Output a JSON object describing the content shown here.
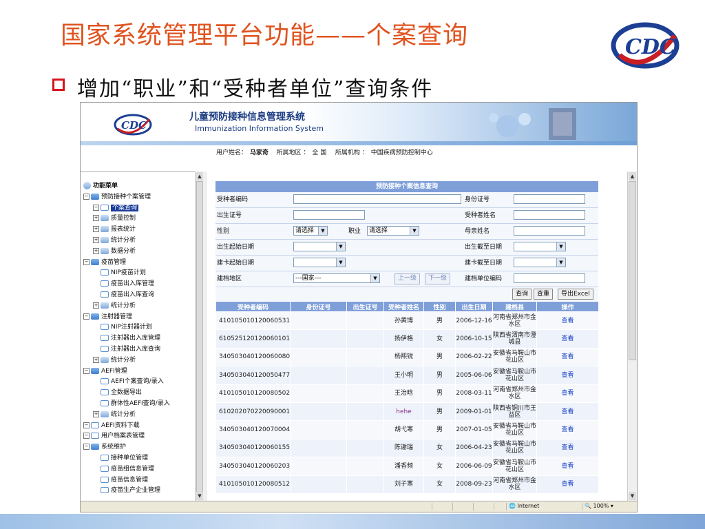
{
  "slide": {
    "title": "国家系统管理平台功能——个案查询",
    "bullet": "增加“职业”和“受种者单位”查询条件"
  },
  "system": {
    "name_cn": "儿童预防接种信息管理系统",
    "name_en": "Immunization Information System",
    "user_label": "用户姓名：",
    "user_name": "马家奇",
    "region_label": "所属地区 ：",
    "region": "全 国",
    "org_label": "所属机构 ：",
    "org": "中国疾病预防控制中心"
  },
  "menu": {
    "header": "功能菜单",
    "items": [
      {
        "label": "预防接种个案管理",
        "toggle": "⊟",
        "icon": "folder",
        "level": 0
      },
      {
        "label": "个案查询",
        "toggle": "⊟",
        "icon": "doc",
        "level": 1,
        "selected": true
      },
      {
        "label": "质量控制",
        "toggle": "⊞",
        "icon": "multi",
        "level": 1
      },
      {
        "label": "报表统计",
        "toggle": "⊞",
        "icon": "multi",
        "level": 1
      },
      {
        "label": "统计分析",
        "toggle": "⊞",
        "icon": "multi",
        "level": 1
      },
      {
        "label": "数据分析",
        "toggle": "⊞",
        "icon": "multi",
        "level": 1
      },
      {
        "label": "疫苗管理",
        "toggle": "⊟",
        "icon": "folder",
        "level": 0
      },
      {
        "label": "NIP疫苗计划",
        "toggle": "",
        "icon": "doc",
        "level": 1
      },
      {
        "label": "疫苗出入库管理",
        "toggle": "",
        "icon": "doc",
        "level": 1
      },
      {
        "label": "疫苗出入库查询",
        "toggle": "",
        "icon": "doc",
        "level": 1
      },
      {
        "label": "统计分析",
        "toggle": "⊞",
        "icon": "multi",
        "level": 1
      },
      {
        "label": "注射器管理",
        "toggle": "⊟",
        "icon": "folder",
        "level": 0
      },
      {
        "label": "NIP注射器计划",
        "toggle": "",
        "icon": "doc",
        "level": 1
      },
      {
        "label": "注射器出入库管理",
        "toggle": "",
        "icon": "doc",
        "level": 1
      },
      {
        "label": "注射器出入库查询",
        "toggle": "",
        "icon": "doc",
        "level": 1
      },
      {
        "label": "统计分析",
        "toggle": "⊞",
        "icon": "multi",
        "level": 1
      },
      {
        "label": "AEFI管理",
        "toggle": "⊟",
        "icon": "folder",
        "level": 0
      },
      {
        "label": "AEFI个案查询/录入",
        "toggle": "",
        "icon": "doc",
        "level": 1
      },
      {
        "label": "全数据导出",
        "toggle": "",
        "icon": "doc",
        "level": 1
      },
      {
        "label": "群体性AEFI查询/录入",
        "toggle": "",
        "icon": "doc",
        "level": 1
      },
      {
        "label": "统计分析",
        "toggle": "⊞",
        "icon": "multi",
        "level": 1
      },
      {
        "label": "AEFI资料下载",
        "toggle": "⊟",
        "icon": "doc",
        "level": 0
      },
      {
        "label": "用户档案表管理",
        "toggle": "⊟",
        "icon": "doc",
        "level": 0
      },
      {
        "label": "系统维护",
        "toggle": "⊟",
        "icon": "folder",
        "level": 0
      },
      {
        "label": "接种单位管理",
        "toggle": "",
        "icon": "doc",
        "level": 1
      },
      {
        "label": "疫苗组信息管理",
        "toggle": "",
        "icon": "doc",
        "level": 1
      },
      {
        "label": "疫苗信息管理",
        "toggle": "",
        "icon": "doc",
        "level": 1
      },
      {
        "label": "疫苗生产企业管理",
        "toggle": "",
        "icon": "doc",
        "level": 1
      }
    ]
  },
  "query": {
    "title": "预防接种个案信息查询",
    "labels": {
      "recipient_code": "受种者编码",
      "id_number": "身份证号",
      "birth_cert": "出生证号",
      "recipient_name": "受种者姓名",
      "gender": "性别",
      "occupation": "职业",
      "mother_name": "母亲姓名",
      "birth_start": "出生起始日期",
      "birth_end": "出生截至日期",
      "card_start": "建卡起始日期",
      "card_end": "建卡截至日期",
      "file_region": "建档地区",
      "file_unit_code": "建档单位编码"
    },
    "gender_value": "请选择",
    "occupation_value": "请选择",
    "region_value": "---国家---",
    "btn_up": "上一级",
    "btn_down": "下一级",
    "btn_query": "查询",
    "btn_reset": "查重",
    "btn_export": "导出Excel"
  },
  "results": {
    "columns": [
      "受种者编码",
      "身份证号",
      "出生证号",
      "受种者姓名",
      "性别",
      "出生日期",
      "建档县",
      "操作"
    ],
    "rows": [
      {
        "code": "410105010120060531",
        "name": "孙黄博",
        "gender": "男",
        "dob": "2006-12-16",
        "county": "河南省郑州市金水区",
        "op": "查看"
      },
      {
        "code": "610525120120060101",
        "name": "扬伊格",
        "gender": "女",
        "dob": "2006-10-15",
        "county": "陕西省渭南市澄城县",
        "op": "查看"
      },
      {
        "code": "340503040120060080",
        "name": "杨熙锐",
        "gender": "男",
        "dob": "2006-02-22",
        "county": "安徽省马鞍山市花山区",
        "op": "查看"
      },
      {
        "code": "340503040120050477",
        "name": "王小明",
        "gender": "男",
        "dob": "2005-06-06",
        "county": "安徽省马鞍山市花山区",
        "op": "查看"
      },
      {
        "code": "410105010120080502",
        "name": "王治晗",
        "gender": "男",
        "dob": "2008-03-11",
        "county": "河南省郑州市金水区",
        "op": "查看"
      },
      {
        "code": "610202070220090001",
        "name": "hehe",
        "gender": "男",
        "dob": "2009-01-01",
        "county": "陕西省铜川市王益区",
        "op": "查看"
      },
      {
        "code": "340503040120070004",
        "name": "胡弋寒",
        "gender": "男",
        "dob": "2007-01-05",
        "county": "安徽省马鞍山市花山区",
        "op": "查看"
      },
      {
        "code": "340503040120060155",
        "name": "陈谢瑞",
        "gender": "女",
        "dob": "2006-04-23",
        "county": "安徽省马鞍山市花山区",
        "op": "查看"
      },
      {
        "code": "340503040120060203",
        "name": "潘香频",
        "gender": "女",
        "dob": "2006-06-09",
        "county": "安徽省马鞍山市花山区",
        "op": "查看"
      },
      {
        "code": "410105010120080512",
        "name": "刘子寒",
        "gender": "女",
        "dob": "2008-09-23",
        "county": "河南省郑州市金水区",
        "op": "查看"
      }
    ]
  },
  "status": {
    "zone": "Internet",
    "zoom": "100%"
  },
  "colors": {
    "title": "#e0531f",
    "header_bar": "#7f9fd9",
    "link": "#1b43c9"
  }
}
